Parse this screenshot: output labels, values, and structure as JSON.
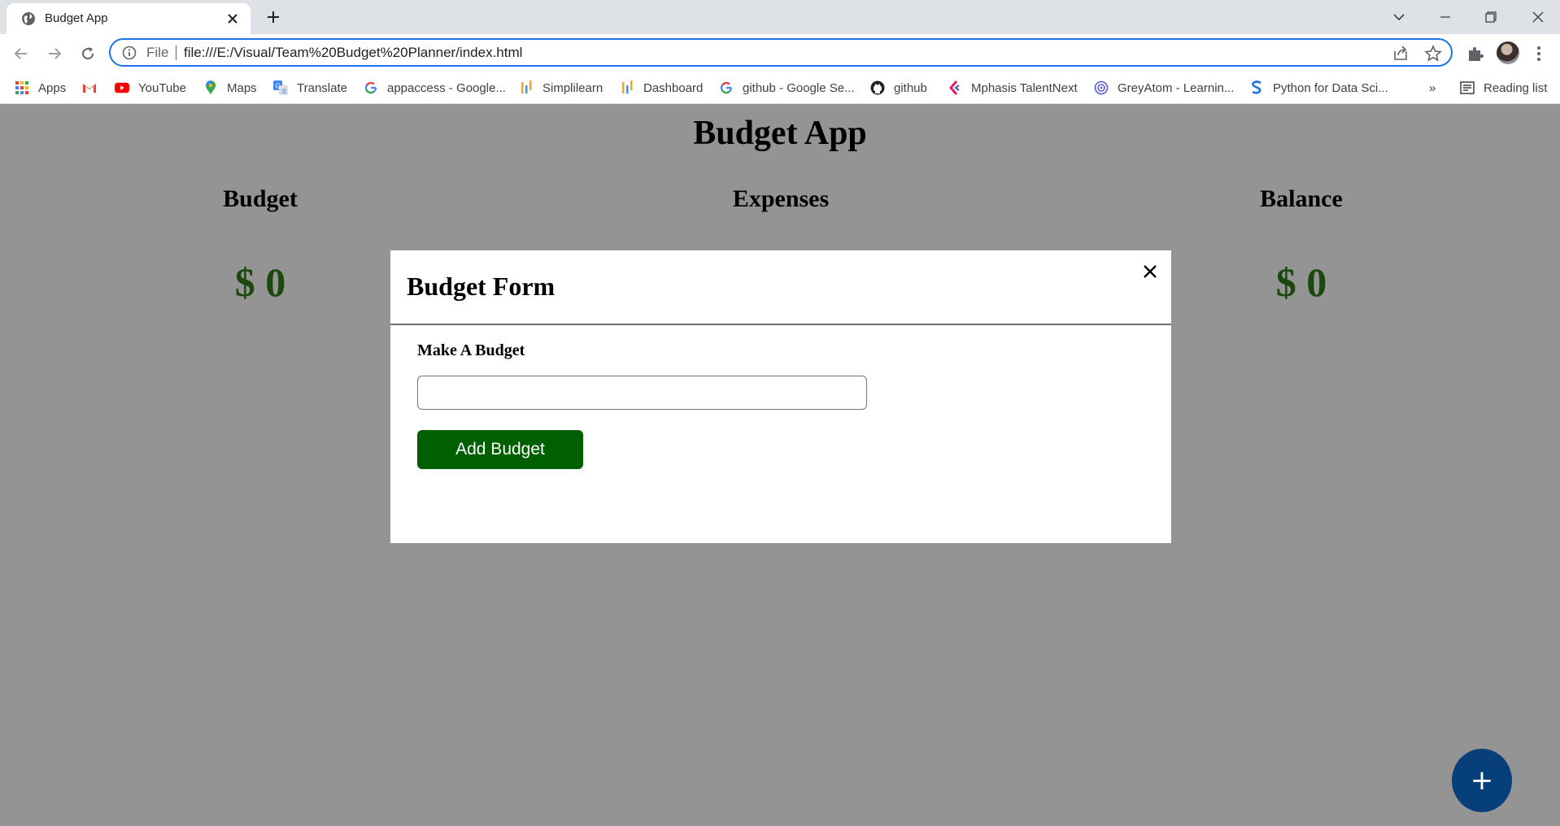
{
  "browser": {
    "tab": {
      "title": "Budget App"
    },
    "address_bar": {
      "scheme_label": "File",
      "url": "file:///E:/Visual/Team%20Budget%20Planner/index.html"
    },
    "bookmarks": [
      {
        "label": "Apps",
        "icon": "apps-grid-icon"
      },
      {
        "label": "",
        "icon": "gmail-icon"
      },
      {
        "label": "YouTube",
        "icon": "youtube-icon"
      },
      {
        "label": "Maps",
        "icon": "maps-pin-icon"
      },
      {
        "label": "Translate",
        "icon": "translate-icon"
      },
      {
        "label": "appaccess - Google...",
        "icon": "google-icon"
      },
      {
        "label": "Simplilearn",
        "icon": "bars-icon"
      },
      {
        "label": "Dashboard",
        "icon": "bars-icon"
      },
      {
        "label": "github - Google Se...",
        "icon": "google-icon"
      },
      {
        "label": "github",
        "icon": "github-icon"
      },
      {
        "label": "Mphasis TalentNext",
        "icon": "mphasis-icon"
      },
      {
        "label": "GreyAtom - Learnin...",
        "icon": "greyatom-icon"
      },
      {
        "label": "Python for Data Sci...",
        "icon": "s-icon"
      }
    ],
    "bookmarks_overflow": "»",
    "reading_list": "Reading list"
  },
  "app": {
    "title": "Budget App",
    "summary": [
      {
        "label": "Budget",
        "value": "$ 0"
      },
      {
        "label": "Expenses",
        "value": ""
      },
      {
        "label": "Balance",
        "value": "$ 0"
      }
    ],
    "fab_label": "+"
  },
  "modal": {
    "title": "Budget Form",
    "field_label": "Make A Budget",
    "input_value": "",
    "submit_label": "Add Budget"
  },
  "colors": {
    "value_green": "#2e7d17",
    "button_green": "#005f00",
    "fab_blue": "#063f7a",
    "focus_blue": "#1a73e8"
  }
}
